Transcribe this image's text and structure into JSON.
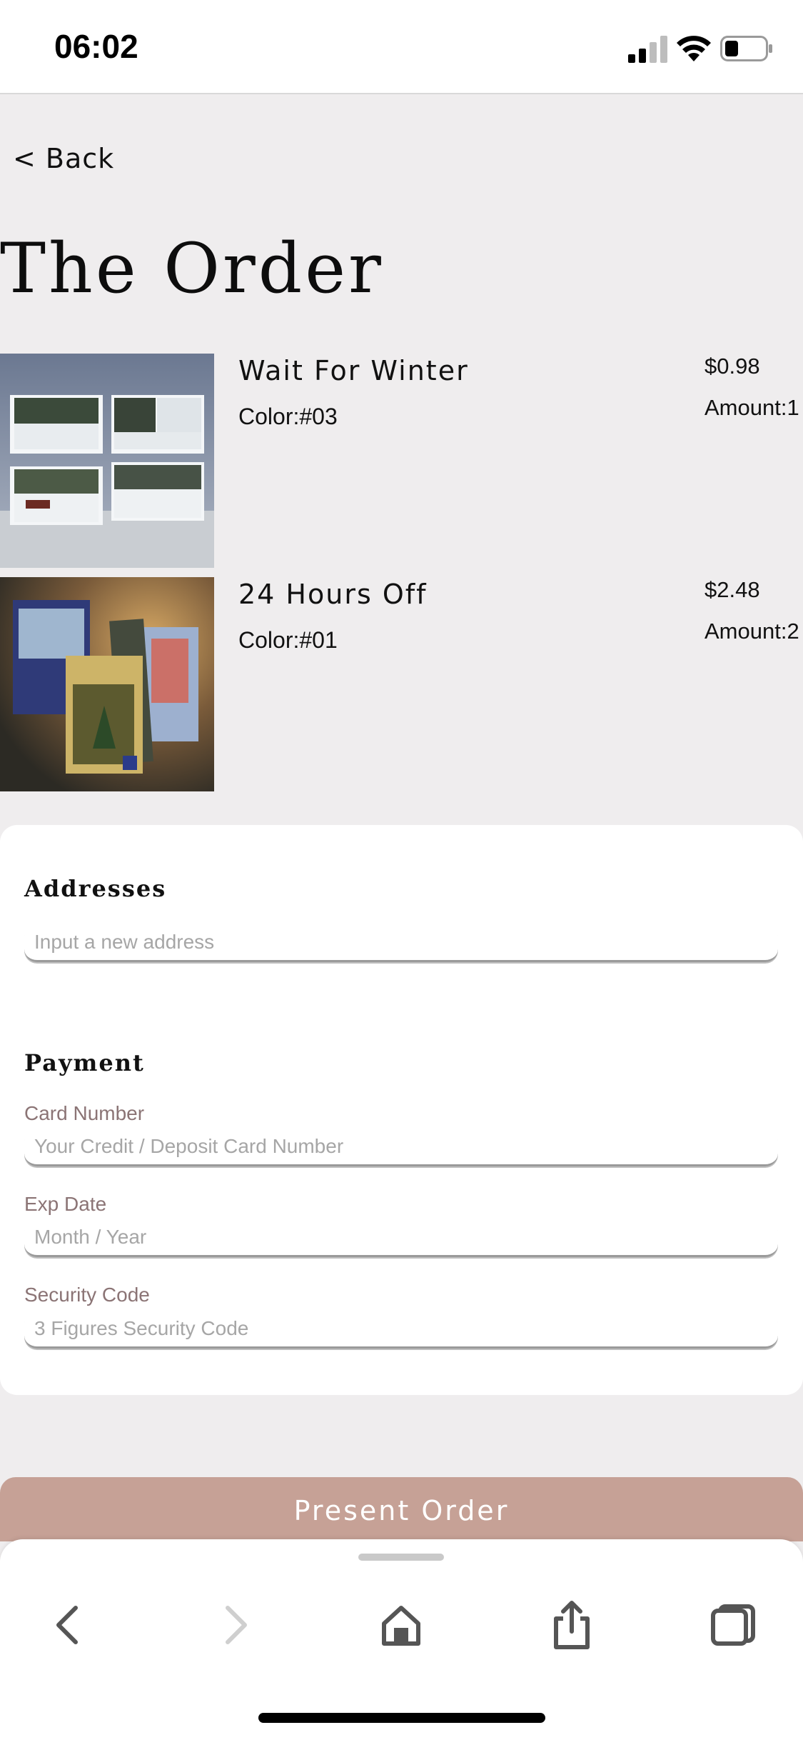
{
  "status_bar": {
    "time": "06:02",
    "icons": [
      "cellular-signal-icon",
      "wifi-icon",
      "battery-icon"
    ]
  },
  "nav": {
    "back_label": "< Back"
  },
  "page": {
    "title": "The Order"
  },
  "order_items": [
    {
      "name": "Wait For Winter",
      "color": "Color:#03",
      "price": "$0.98",
      "amount": "Amount:1"
    },
    {
      "name": "24 Hours Off",
      "color": "Color:#01",
      "price": "$2.48",
      "amount": "Amount:2"
    }
  ],
  "addresses": {
    "title": "Addresses",
    "placeholder": "Input a new address"
  },
  "payment": {
    "title": "Payment",
    "card_number_label": "Card Number",
    "card_number_placeholder": "Your Credit / Deposit Card Number",
    "exp_date_label": "Exp Date",
    "exp_date_placeholder": "Month / Year",
    "security_code_label": "Security Code",
    "security_code_placeholder": "3 Figures Security Code"
  },
  "actions": {
    "present_order_label": "Present Order"
  },
  "browser_toolbar": {
    "icons": [
      "back-arrow-icon",
      "forward-arrow-icon",
      "home-icon",
      "share-icon",
      "tabs-icon"
    ]
  },
  "colors": {
    "background": "#efedee",
    "accent": "#c6a196",
    "label": "#8b7475"
  }
}
